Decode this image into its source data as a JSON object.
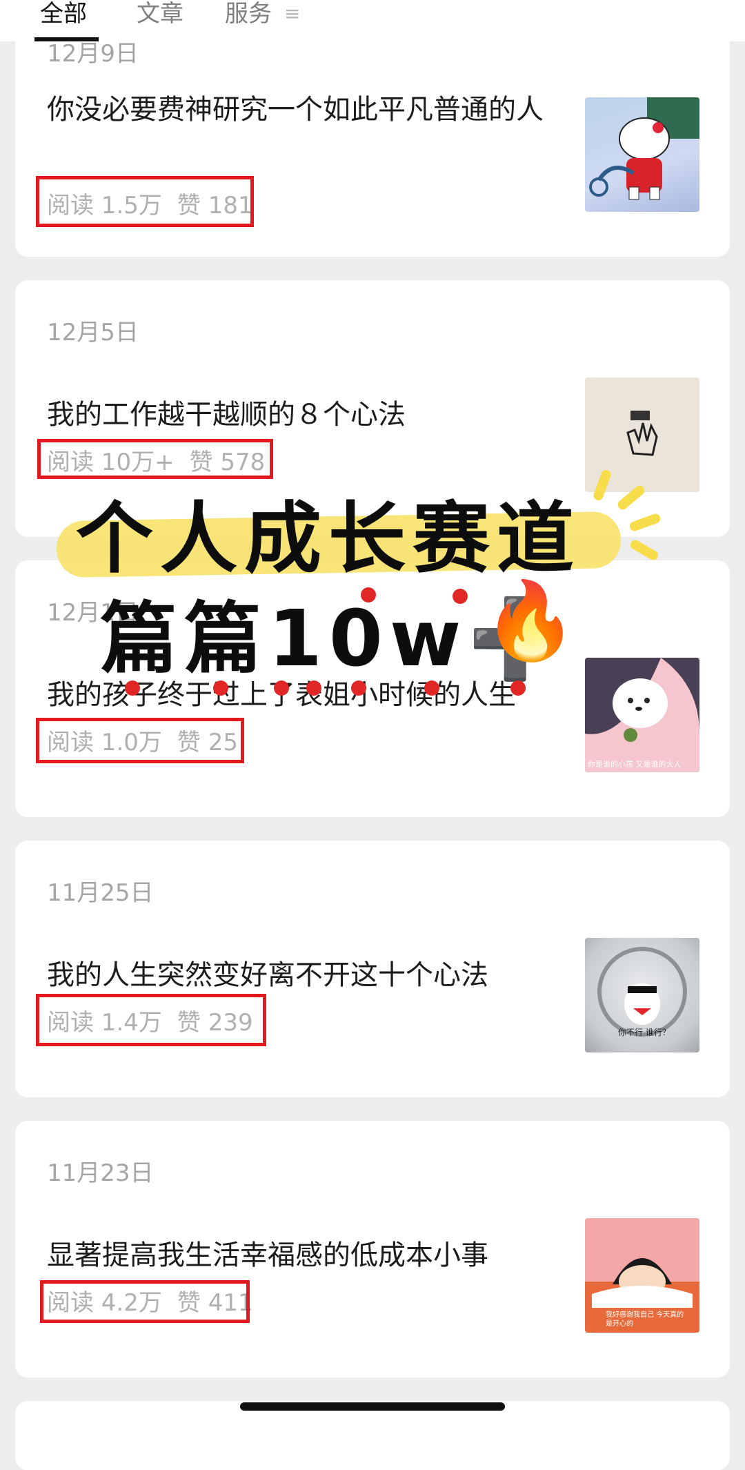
{
  "tabs": [
    {
      "label": "全部",
      "active": true
    },
    {
      "label": "文章",
      "active": false
    },
    {
      "label": "服务",
      "active": false
    }
  ],
  "menu_icon": "menu-icon",
  "articles": [
    {
      "date": "12月9日",
      "title": "你没必要费神研究一个如此平凡普通的人",
      "reads": "阅读 1.5万",
      "likes": "赞 181",
      "thumb": "hello-kitty-crying"
    },
    {
      "date": "12月5日",
      "title": "我的工作越干越顺的８个心法",
      "reads": "阅读 10万+",
      "likes": "赞 578",
      "thumb": "hand-gesture-sketch"
    },
    {
      "date": "12月1日",
      "title": "我的孩子终于过上了表姐小时候的人生",
      "reads": "阅读 1.0万",
      "likes": "赞 25",
      "thumb": "white-dog-cartoon",
      "thumb_caption": "你是谁的小孩 又是谁的大人"
    },
    {
      "date": "11月25日",
      "title": "我的人生突然变好离不开这十个心法",
      "reads": "阅读 1.4万",
      "likes": "赞 239",
      "thumb": "white-bird-meme",
      "thumb_caption": "你不行 谁行？"
    },
    {
      "date": "11月23日",
      "title": "显著提高我生活幸福感的低成本小事",
      "reads": "阅读 4.2万",
      "likes": "赞 411",
      "thumb": "maruko-cartoon",
      "thumb_caption": "我好感谢我自己 今天真的是开心的"
    }
  ],
  "overlay": {
    "line1": "个人成长赛道",
    "line2": "篇篇10w",
    "plus": "➕",
    "flame": "🔥"
  },
  "colors": {
    "highlight": "#e4191f",
    "band": "#f7e26b"
  }
}
